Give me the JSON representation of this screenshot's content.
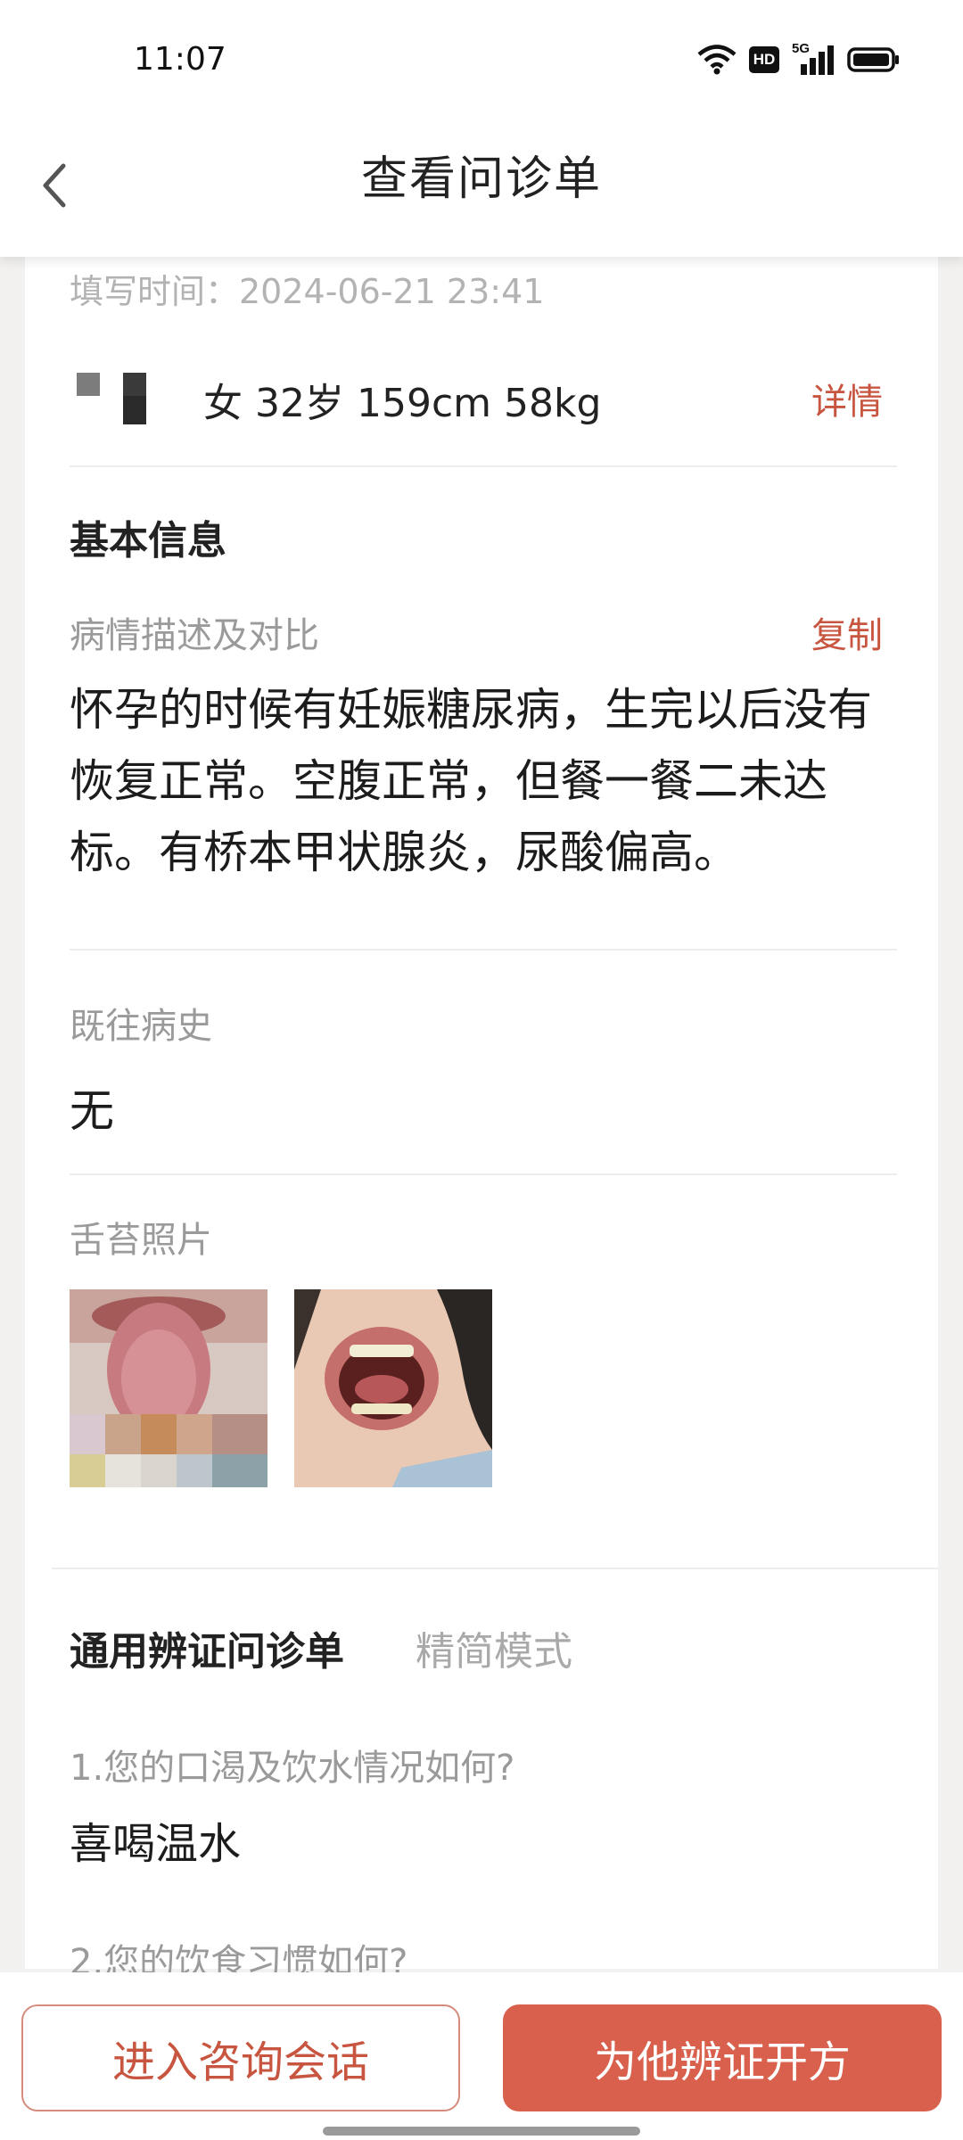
{
  "status_bar": {
    "time": "11:07",
    "icons": [
      "wifi-icon",
      "hd-icon",
      "5g-signal-icon",
      "battery-icon"
    ],
    "hd_label": "HD",
    "network_label": "5G"
  },
  "header": {
    "title": "查看问诊单",
    "back_icon": "back-arrow-icon"
  },
  "record": {
    "fill_time": "填写时间：2024-06-21 23:41",
    "patient_info": "女 32岁 159cm 58kg",
    "details_label": "详情"
  },
  "basic_info": {
    "section_title": "基本信息",
    "description_label": "病情描述及对比",
    "copy_label": "复制",
    "description_text": "怀孕的时候有妊娠糖尿病，生完以后没有恢复正常。空腹正常，但餐一餐二未达标。有桥本甲状腺炎，尿酸偏高。",
    "history_label": "既往病史",
    "history_value": "无",
    "tongue_photos_label": "舌苔照片"
  },
  "questionnaire": {
    "tab_general": "通用辨证问诊单",
    "tab_simple": "精简模式",
    "questions": [
      {
        "q": "1.您的口渴及饮水情况如何?",
        "a": "喜喝温水"
      },
      {
        "q": "2.您的饮食习惯如何?",
        "a": ""
      }
    ]
  },
  "actions": {
    "enter_consult": "进入咨询会话",
    "prescribe": "为他辨证开方"
  },
  "colors": {
    "accent": "#c7553f",
    "primary_button": "#d9604c",
    "background": "#f2f1ef"
  }
}
